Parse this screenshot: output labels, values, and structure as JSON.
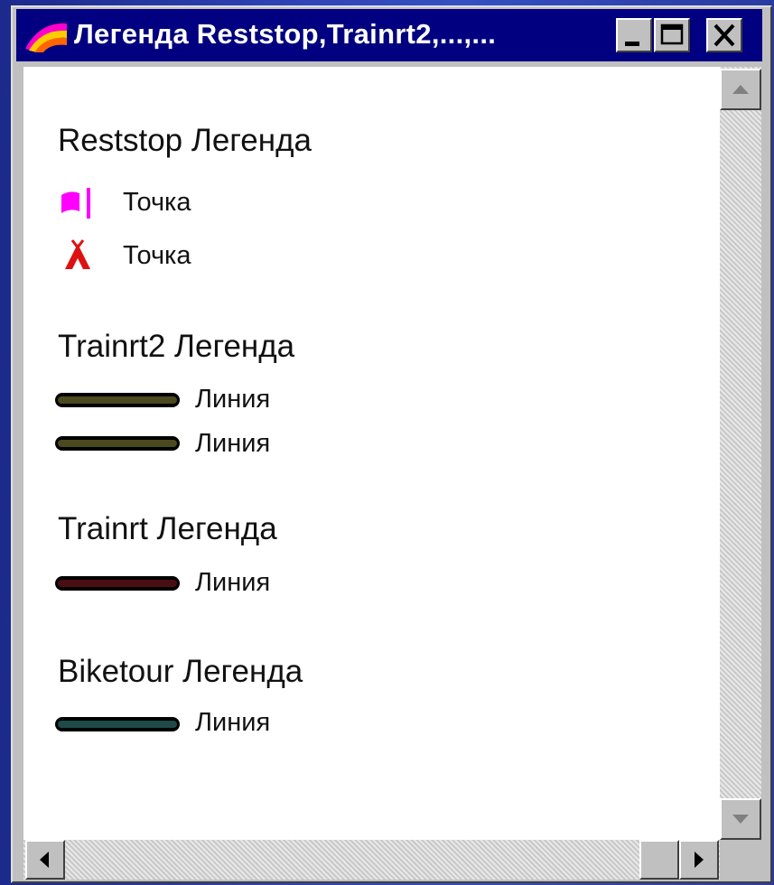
{
  "window": {
    "title": "Легенда Reststop,Trainrt2,...,..."
  },
  "legends": [
    {
      "heading": "Reststop Легенда",
      "items": [
        {
          "symbol": "magenta-flag-icon",
          "label": "Точка"
        },
        {
          "symbol": "red-tent-icon",
          "label": "Точка"
        }
      ]
    },
    {
      "heading": "Trainrt2 Легенда",
      "items": [
        {
          "symbol": "line",
          "color": "#4a4a1e",
          "edge": "#000000",
          "label": "Линия"
        },
        {
          "symbol": "line",
          "color": "#4a4a1e",
          "edge": "#000000",
          "label": "Линия"
        }
      ]
    },
    {
      "heading": "Trainrt Легенда",
      "items": [
        {
          "symbol": "line",
          "color": "#4a0e12",
          "edge": "#000000",
          "label": "Линия"
        }
      ]
    },
    {
      "heading": "Biketour Легенда",
      "items": [
        {
          "symbol": "line",
          "color": "#1f4a48",
          "edge": "#000000",
          "label": "Линия"
        }
      ]
    }
  ],
  "colors": {
    "titlebar": "#000080",
    "point_magenta": "#ff00ff",
    "point_red": "#dd1111"
  }
}
